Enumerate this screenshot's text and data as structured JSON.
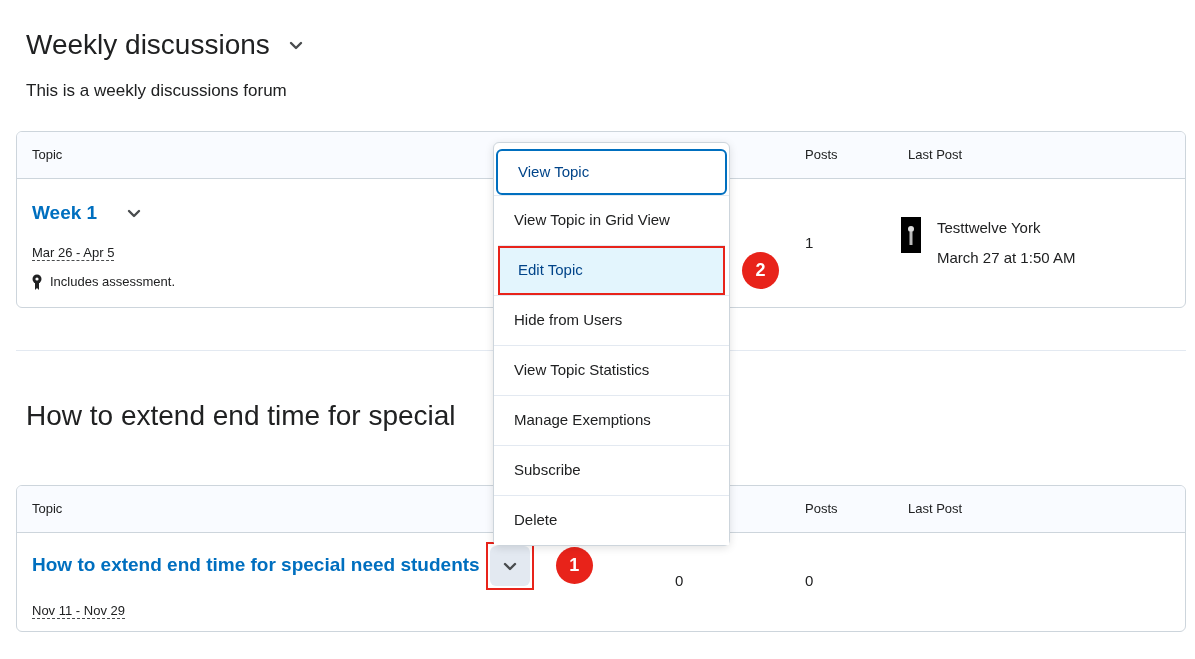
{
  "sections": [
    {
      "title": "Weekly discussions",
      "collapsible": true,
      "description": "This is a weekly discussions forum",
      "topic_column": "Topic",
      "posts_column": "Posts",
      "last_post_column": "Last Post",
      "rows": [
        {
          "title": "Week 1",
          "menu_open": false,
          "date": "Mar 26 - Apr 5",
          "note": "Includes assessment.",
          "posts": "1",
          "last_post": {
            "author": "Testtwelve York",
            "time": "March 27 at 1:50 AM"
          }
        }
      ]
    },
    {
      "title": "How to extend end time for special",
      "collapsible": false,
      "topic_column": "Topic",
      "posts_column": "Posts",
      "last_post_column": "Last Post",
      "rows": [
        {
          "title": "How to extend end time for special need students",
          "menu_open": true,
          "button_callout": "1",
          "date": "Nov 11 - Nov 29",
          "column_2": "0",
          "posts": "0"
        }
      ]
    }
  ],
  "menu": {
    "items": [
      {
        "label": "View Topic",
        "focused": true,
        "highlighted": false
      },
      {
        "label": "View Topic in Grid View",
        "focused": false,
        "highlighted": false
      },
      {
        "label": "Edit Topic",
        "focused": false,
        "highlighted": true,
        "callout": "2"
      },
      {
        "label": "Hide from Users",
        "focused": false,
        "highlighted": false
      },
      {
        "label": "View Topic Statistics",
        "focused": false,
        "highlighted": false
      },
      {
        "label": "Manage Exemptions",
        "focused": false,
        "highlighted": false
      },
      {
        "label": "Subscribe",
        "focused": false,
        "highlighted": false
      },
      {
        "label": "Delete",
        "focused": false,
        "highlighted": false
      }
    ]
  }
}
